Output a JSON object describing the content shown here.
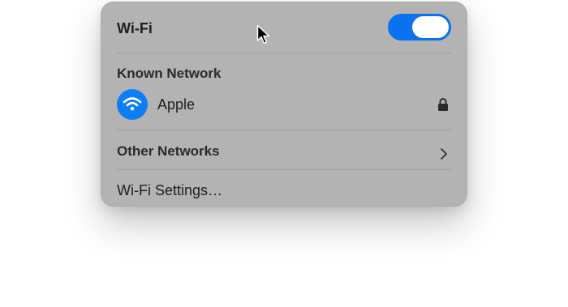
{
  "menu": {
    "title": "Wi-Fi",
    "toggle_state": "on",
    "known_network_label": "Known Network",
    "known_network": {
      "name": "Apple",
      "icon": "wifi-icon",
      "secured_icon": "lock-icon"
    },
    "other_networks_label": "Other Networks",
    "other_networks_icon": "chevron-right-icon",
    "settings_label": "Wi-Fi Settings…"
  },
  "colors": {
    "accent": "#0a72f0",
    "panel": "#b3b3b3"
  }
}
